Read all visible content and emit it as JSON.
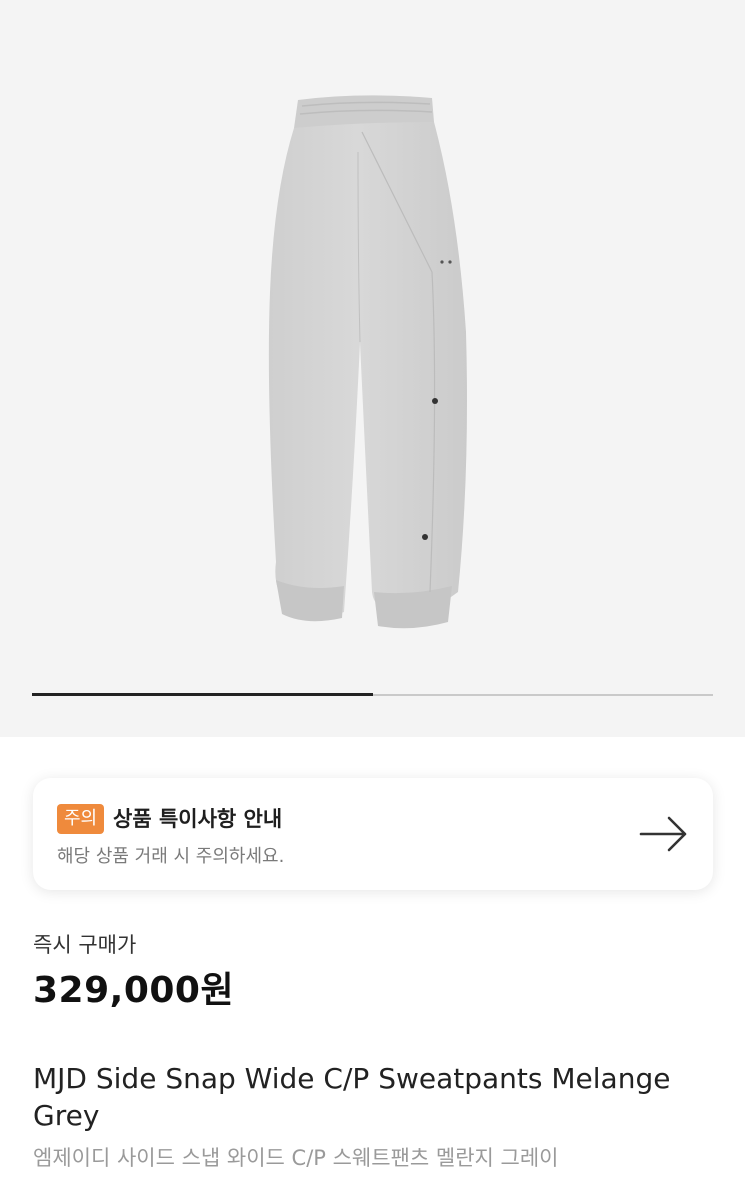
{
  "gallery": {
    "image_alt": "grey sweatpants product photo",
    "progress": 0.5
  },
  "notice": {
    "badge": "주의",
    "title": "상품 특이사항 안내",
    "description": "해당 상품 거래 시 주의하세요."
  },
  "price": {
    "label": "즉시 구매가",
    "value": "329,000원"
  },
  "product": {
    "name_en": "MJD Side Snap Wide C/P Sweatpants Melange Grey",
    "name_ko": "엠제이디 사이드 스냅 와이드 C/P 스웨트팬츠 멜란지 그레이"
  },
  "colors": {
    "badge": "#ef8a3c",
    "hero_bg": "#f4f4f4"
  }
}
